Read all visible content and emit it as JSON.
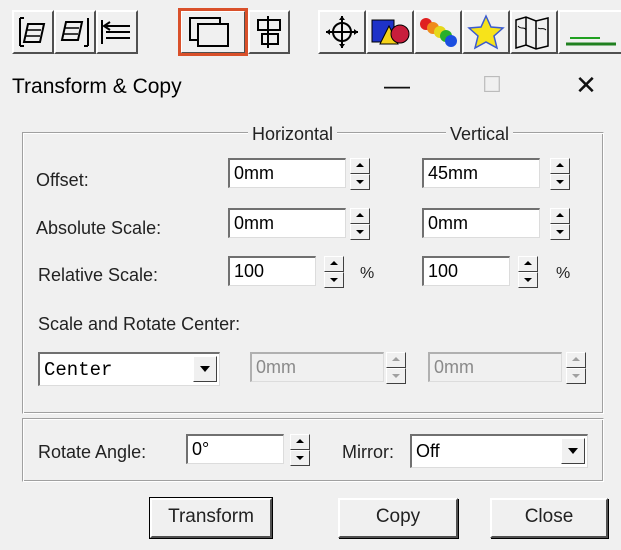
{
  "window": {
    "title": "Transform & Copy",
    "minimize_glyph": "—",
    "maximize_glyph": "☐",
    "close_glyph": "✕"
  },
  "toolbar": {
    "buttons": [
      {
        "icon": "align-left-icon"
      },
      {
        "icon": "align-right-icon"
      },
      {
        "icon": "flip-horizontal-icon"
      },
      {
        "icon": "transform-copy-icon",
        "selected": true
      },
      {
        "icon": "align-center-icon"
      },
      {
        "icon": "move-crosshair-icon"
      },
      {
        "icon": "shapes-color-icon"
      },
      {
        "icon": "rainbow-gradient-icon"
      },
      {
        "icon": "star-icon"
      },
      {
        "icon": "map-icon"
      },
      {
        "icon": "chart-icon"
      }
    ],
    "selected_color": "#d9502a"
  },
  "headers": {
    "horizontal": "Horizontal",
    "vertical": "Vertical"
  },
  "offset": {
    "label": "Offset:",
    "horizontal": "0mm",
    "vertical": "45mm"
  },
  "absolute_scale": {
    "label": "Absolute Scale:",
    "horizontal": "0mm",
    "vertical": "0mm"
  },
  "relative_scale": {
    "label": "Relative Scale:",
    "horizontal": "100",
    "vertical": "100",
    "unit": "%"
  },
  "center": {
    "label": "Scale and Rotate Center:",
    "selected": "Center",
    "horizontal": "0mm",
    "vertical": "0mm"
  },
  "rotate": {
    "label": "Rotate Angle:",
    "value": "0°"
  },
  "mirror": {
    "label": "Mirror:",
    "selected": "Off"
  },
  "buttons": {
    "transform": "Transform",
    "copy": "Copy",
    "close": "Close"
  }
}
